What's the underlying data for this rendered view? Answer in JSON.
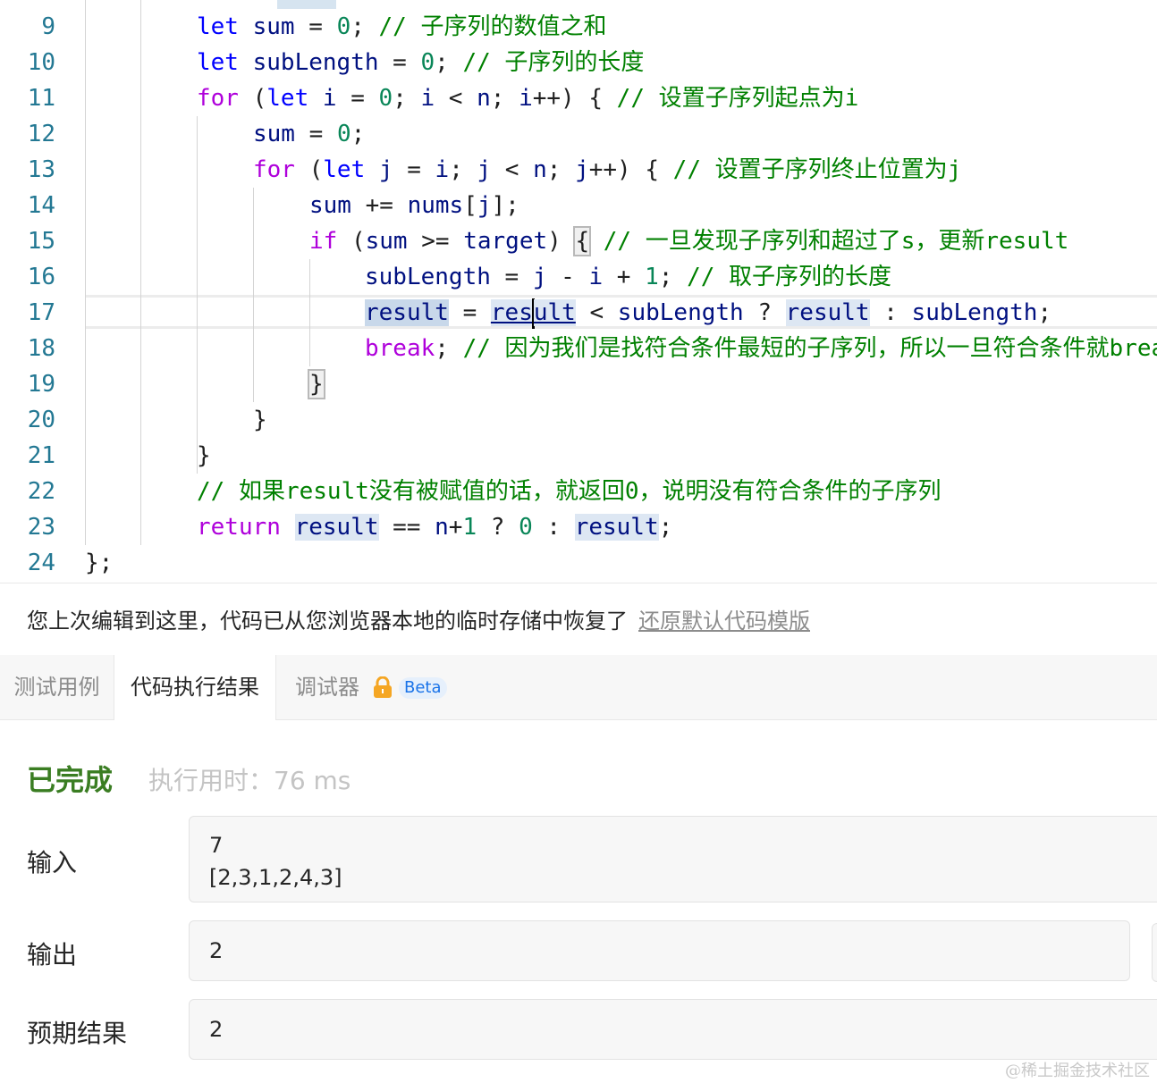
{
  "editor": {
    "line_numbers": [
      "9",
      "10",
      "11",
      "12",
      "13",
      "14",
      "15",
      "16",
      "17",
      "18",
      "19",
      "20",
      "21",
      "22",
      "23",
      "24"
    ],
    "l9": {
      "kw": "let",
      "var": "sum",
      "eq": " = ",
      "num": "0",
      "semi": "; ",
      "comment": "// 子序列的数值之和"
    },
    "l10": {
      "kw": "let",
      "var": "subLength",
      "eq": " = ",
      "num": "0",
      "semi": "; ",
      "comment": "// 子序列的长度"
    },
    "l11": {
      "kw": "for",
      "p1": " (",
      "kw2": "let",
      "var_i": "i",
      "eq": " = ",
      "num": "0",
      "rest1": "; ",
      "var_i2": "i",
      "lt": " < ",
      "var_n": "n",
      "rest2": "; ",
      "var_i3": "i",
      "inc": "++) { ",
      "comment": "// 设置子序列起点为i"
    },
    "l12": {
      "var": "sum",
      "eq": " = ",
      "num": "0",
      "semi": ";"
    },
    "l13": {
      "kw": "for",
      "p1": " (",
      "kw2": "let",
      "var_j": "j",
      "eq": " = ",
      "var_i": "i",
      "rest1": "; ",
      "var_j2": "j",
      "lt": " < ",
      "var_n": "n",
      "rest2": "; ",
      "var_j3": "j",
      "inc": "++) { ",
      "comment": "// 设置子序列终止位置为j"
    },
    "l14": {
      "var": "sum",
      "op": " += ",
      "var2": "nums",
      "b1": "[",
      "var3": "j",
      "b2": "];"
    },
    "l15": {
      "kw": "if",
      "p1": " (",
      "var": "sum",
      "op": " >= ",
      "var2": "target",
      "p2": ") ",
      "brace": "{",
      "sp": " ",
      "comment": "// 一旦发现子序列和超过了s，更新result"
    },
    "l16": {
      "var": "subLength",
      "eq": " = ",
      "var_j": "j",
      "minus": " - ",
      "var_i": "i",
      "plus": " + ",
      "num": "1",
      "semi": "; ",
      "comment": "// 取子序列的长度"
    },
    "l17": {
      "var": "result",
      "eq": " = ",
      "link_a": "res",
      "link_b": "ult",
      "lt": " < ",
      "var2": "subLength",
      "q": " ? ",
      "var3": "result",
      "colon": " : ",
      "var4": "subLength",
      "semi": ";"
    },
    "l18": {
      "kw": "break",
      "semi": "; ",
      "comment": "// 因为我们是找符合条件最短的子序列，所以一旦符合条件就break"
    },
    "l19": {
      "brace": "}"
    },
    "l20": {
      "brace": "}"
    },
    "l21": {
      "brace": "}"
    },
    "l22": {
      "comment": "// 如果result没有被赋值的话，就返回0，说明没有符合条件的子序列"
    },
    "l23": {
      "kw": "return",
      "sp": " ",
      "var": "result",
      "eq": " == ",
      "var2": "n",
      "plus": "+",
      "num": "1",
      "q": " ? ",
      "num2": "0",
      "colon": " : ",
      "var3": "result",
      "semi": ";"
    },
    "l24": {
      "text": "};"
    }
  },
  "notice": {
    "text": "您上次编辑到这里，代码已从您浏览器本地的临时存储中恢复了",
    "link": "还原默认代码模版"
  },
  "tabs": {
    "testcase": "测试用例",
    "result": "代码执行结果",
    "debugger": "调试器",
    "beta": "Beta",
    "lock_icon": "lock-icon"
  },
  "result": {
    "status": "已完成",
    "exec_time": "执行用时：76 ms",
    "input_label": "输入",
    "input_line1": "7",
    "input_line2": "[2,3,1,2,4,3]",
    "output_label": "输出",
    "output_value": "2",
    "expected_label": "预期结果",
    "expected_value": "2"
  },
  "watermark": "@稀土掘金技术社区",
  "colors": {
    "status_green": "#3a7d22",
    "lock_orange": "#f5a623",
    "beta_blue": "#1a73e8"
  }
}
